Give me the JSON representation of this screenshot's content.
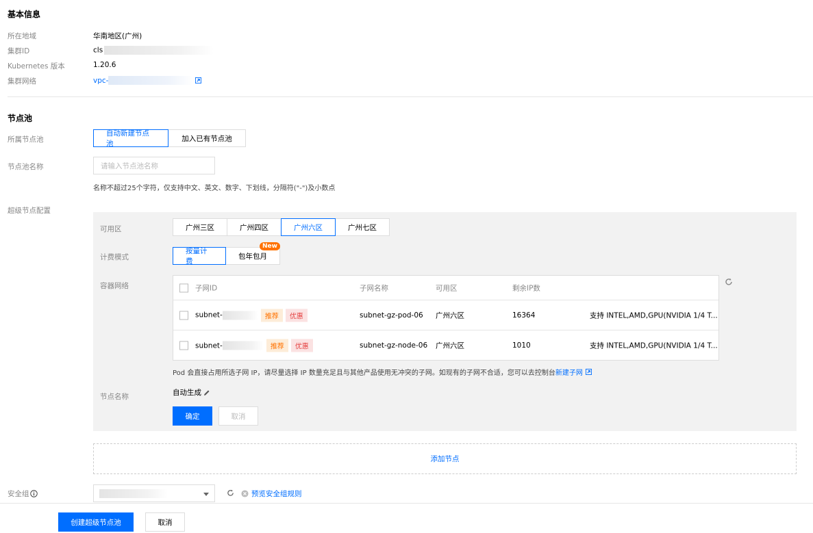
{
  "basic": {
    "title": "基本信息",
    "region_label": "所在地域",
    "region_value": "华南地区(广州)",
    "cluster_id_label": "集群ID",
    "cluster_id_prefix": "cls",
    "k8s_label": "Kubernetes 版本",
    "k8s_value": "1.20.6",
    "network_label": "集群网络",
    "network_prefix": "vpc-"
  },
  "nodepool": {
    "title": "节点池",
    "belong_label": "所属节点池",
    "belong_options": [
      "自动新建节点池",
      "加入已有节点池"
    ],
    "belong_selected": "自动新建节点池",
    "name_label": "节点池名称",
    "name_placeholder": "请输入节点池名称",
    "name_hint": "名称不超过25个字符，仅支持中文、英文、数字、下划线，分隔符(\"-\")及小数点",
    "super_label": "超级节点配置"
  },
  "config": {
    "zone_label": "可用区",
    "zones": [
      "广州三区",
      "广州四区",
      "广州六区",
      "广州七区"
    ],
    "zone_selected": "广州六区",
    "billing_label": "计费模式",
    "billing_options": [
      "按量计费",
      "包年包月"
    ],
    "billing_selected": "按量计费",
    "billing_badge": "New",
    "network_label": "容器网络",
    "table_headers": [
      "子网ID",
      "子网名称",
      "可用区",
      "剩余IP数"
    ],
    "rows": [
      {
        "id_prefix": "subnet-",
        "tag1": "推荐",
        "tag2": "优惠",
        "name": "subnet-gz-pod-06",
        "zone": "广州六区",
        "ip": "16364",
        "support": "支持 INTEL,AMD,GPU(NVIDIA 1/4 T..."
      },
      {
        "id_prefix": "subnet-",
        "tag1": "推荐",
        "tag2": "优惠",
        "name": "subnet-gz-node-06",
        "zone": "广州六区",
        "ip": "1010",
        "support": "支持 INTEL,AMD,GPU(NVIDIA 1/4 T..."
      }
    ],
    "pod_hint": "Pod 会直接占用所选子网 IP，请尽量选择 IP 数量充足且与其他产品使用无冲突的子网。如现有的子网不合适，您可以去控制台",
    "new_subnet_link": "新建子网",
    "node_name_label": "节点名称",
    "node_name_value": "自动生成",
    "confirm_label": "确定",
    "cancel_label": "取消"
  },
  "add_node_label": "添加节点",
  "security": {
    "label": "安全组",
    "preview_link": "预览安全组规则"
  },
  "footer": {
    "create_label": "创建超级节点池",
    "cancel_label": "取消"
  },
  "colors": {
    "primary": "#006eff",
    "orange": "#ff7200",
    "red": "#e54545"
  }
}
